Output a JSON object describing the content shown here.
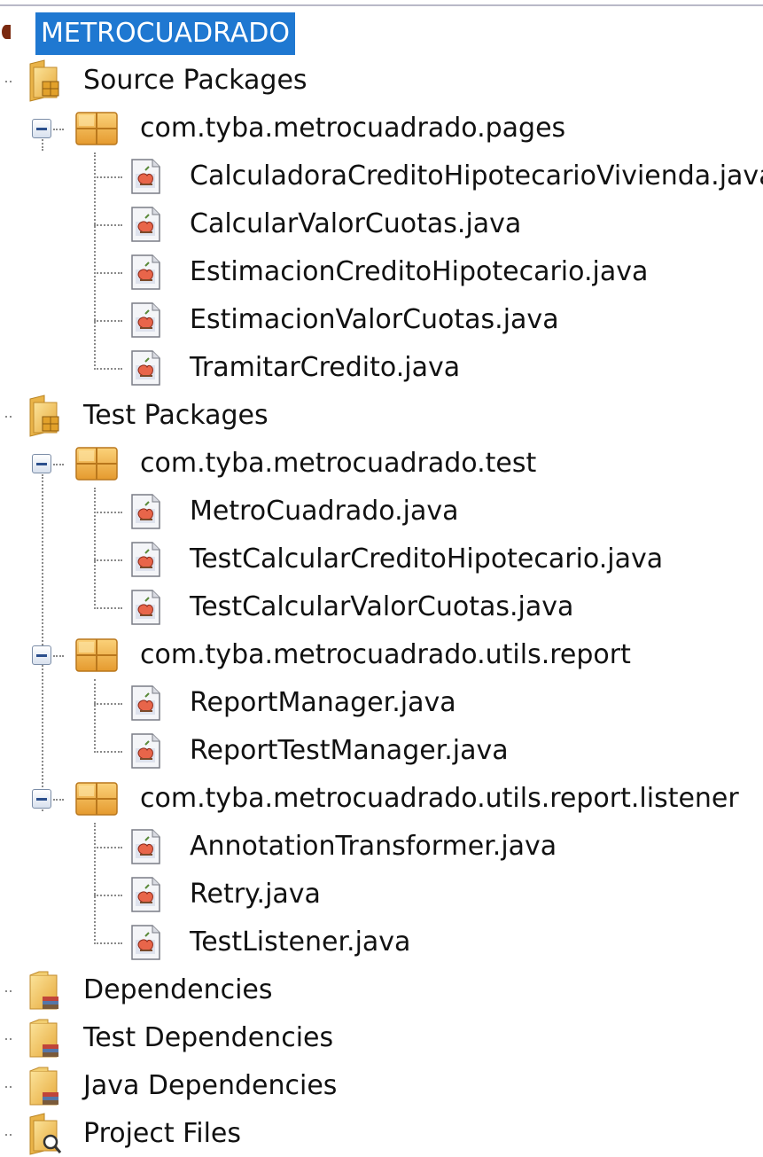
{
  "project": {
    "name": "METROCUADRADO"
  },
  "source_packages": {
    "label": "Source Packages",
    "packages": [
      {
        "name": "com.tyba.metrocuadrado.pages",
        "files": [
          "CalculadoraCreditoHipotecarioVivienda.java",
          "CalcularValorCuotas.java",
          "EstimacionCreditoHipotecario.java",
          "EstimacionValorCuotas.java",
          "TramitarCredito.java"
        ]
      }
    ]
  },
  "test_packages": {
    "label": "Test Packages",
    "packages": [
      {
        "name": "com.tyba.metrocuadrado.test",
        "files": [
          "MetroCuadrado.java",
          "TestCalcularCreditoHipotecario.java",
          "TestCalcularValorCuotas.java"
        ]
      },
      {
        "name": "com.tyba.metrocuadrado.utils.report",
        "files": [
          "ReportManager.java",
          "ReportTestManager.java"
        ]
      },
      {
        "name": "com.tyba.metrocuadrado.utils.report.listener",
        "files": [
          "AnnotationTransformer.java",
          "Retry.java",
          "TestListener.java"
        ]
      }
    ]
  },
  "dependencies": [
    "Dependencies",
    "Test Dependencies",
    "Java Dependencies"
  ],
  "project_files": "Project Files",
  "icons": {
    "source_folder": "source-packages-folder-icon",
    "package": "java-package-icon",
    "java_file": "java-file-icon",
    "library_folder": "library-folder-icon",
    "project_files_folder": "project-files-folder-icon"
  },
  "colors": {
    "selection": "#1f78d1",
    "folder": "#f2c24f",
    "package": "#f0b23a",
    "tree_line": "#8a8a8a"
  }
}
